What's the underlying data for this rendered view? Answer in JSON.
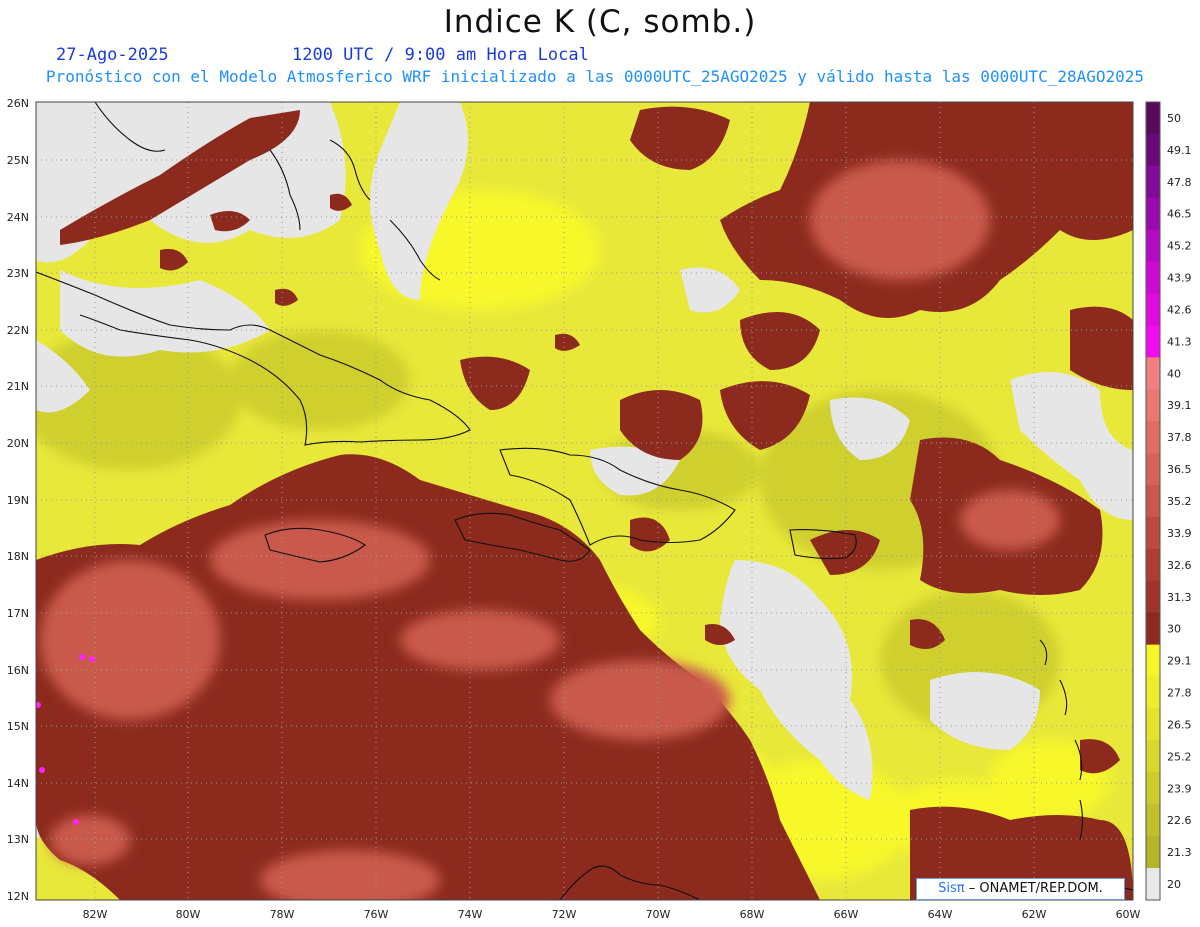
{
  "title": "Indice K (C, somb.)",
  "date": "27-Ago-2025",
  "time": "1200 UTC / 9:00 am Hora Local",
  "forecast": "Pronóstico con el Modelo Atmosferico WRF inicializado a las 0000UTC_25AGO2025 y válido hasta las  0000UTC_28AGO2025",
  "credit": {
    "brand": "Sisπ",
    "org": "– ONAMET/REP.DOM."
  },
  "map": {
    "lat_range": [
      12,
      26
    ],
    "lon_range": [
      -83,
      -60
    ],
    "lat_labels": [
      "26N",
      "25N",
      "24N",
      "23N",
      "22N",
      "21N",
      "20N",
      "19N",
      "18N",
      "17N",
      "16N",
      "15N",
      "14N",
      "13N",
      "12N"
    ],
    "lon_labels": [
      "82W",
      "80W",
      "78W",
      "76W",
      "74W",
      "72W",
      "70W",
      "68W",
      "66W",
      "64W",
      "62W",
      "60W"
    ]
  },
  "colorbar": {
    "levels": [
      "50",
      "49.1",
      "47.8",
      "46.5",
      "45.2",
      "43.9",
      "42.6",
      "41.3",
      "40",
      "39.1",
      "37.8",
      "36.5",
      "35.2",
      "33.9",
      "32.6",
      "31.3",
      "30",
      "29.1",
      "27.8",
      "26.5",
      "25.2",
      "23.9",
      "22.6",
      "21.3",
      "20"
    ],
    "colors": [
      "#5a0a5e",
      "#6a0a78",
      "#820a98",
      "#9a0ab0",
      "#b40ac4",
      "#cc0ad4",
      "#e00ae0",
      "#f20af0",
      "#f08080",
      "#e87870",
      "#df6d62",
      "#d56356",
      "#c9574a",
      "#bc4a3e",
      "#ae3e33",
      "#a0332a",
      "#8c2a1e",
      "#f5f52a",
      "#eded2a",
      "#e3e32a",
      "#d8d82a",
      "#cccc2a",
      "#c0c02a",
      "#b5b52a",
      "#e8e8e8"
    ]
  }
}
